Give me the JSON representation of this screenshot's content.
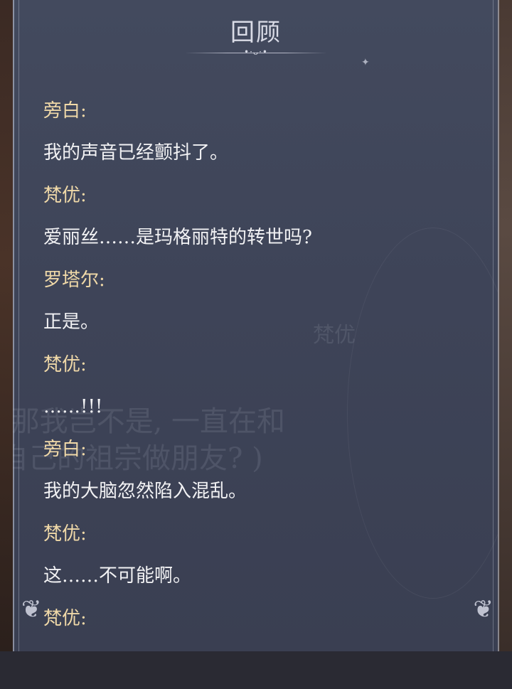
{
  "title": "回顾",
  "title_ornament": "•·ᴗ·•",
  "background_text": {
    "name_tag": "梵优",
    "line1": "(那我岂不是, 一直在和",
    "line2": "自己的祖宗做朋友? )"
  },
  "entries": [
    {
      "speaker": "旁白:",
      "text": "我的声音已经颤抖了。"
    },
    {
      "speaker": "梵优:",
      "text": "爱丽丝……是玛格丽特的转世吗?"
    },
    {
      "speaker": "罗塔尔:",
      "text": "正是。"
    },
    {
      "speaker": "梵优:",
      "text": "……!!!"
    },
    {
      "speaker": "旁白:",
      "text": "我的大脑忽然陷入混乱。"
    },
    {
      "speaker": "梵优:",
      "text": "这……不可能啊。"
    },
    {
      "speaker": "梵优:",
      "text": ""
    }
  ],
  "colors": {
    "panel": "#3e4458",
    "speaker_name": "#f0d9a8",
    "dialogue_text": "#f2f2f4",
    "title_text": "#d9dbe6"
  }
}
